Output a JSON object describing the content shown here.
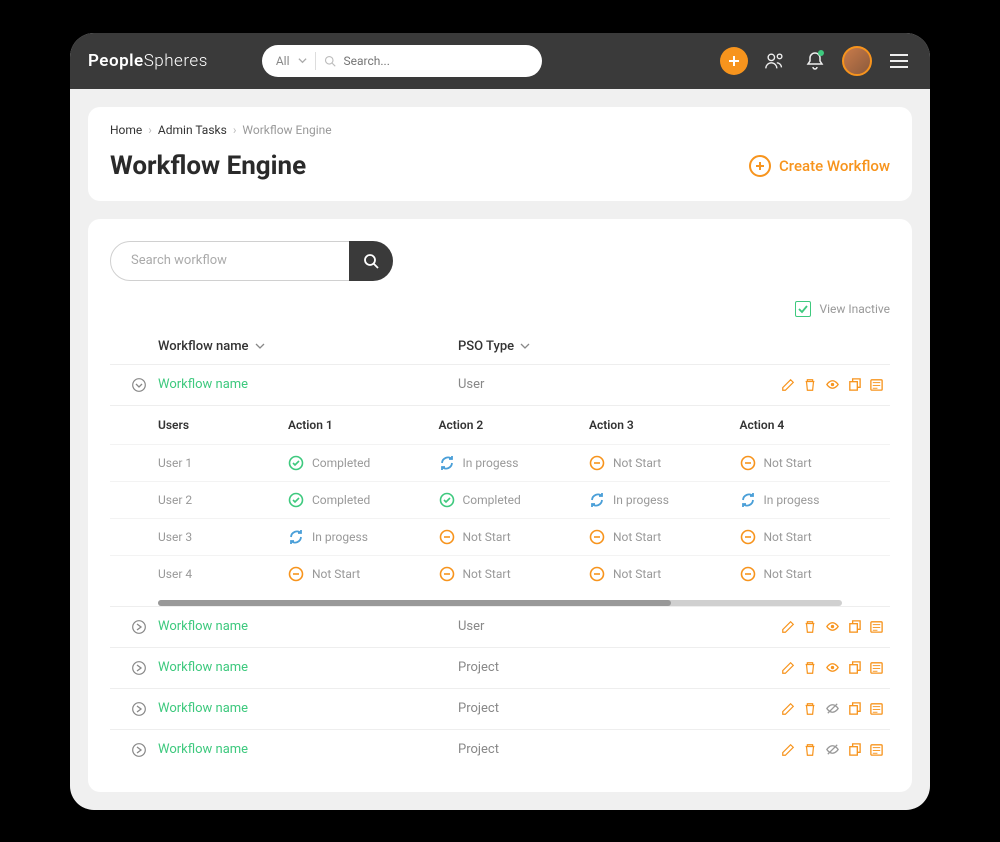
{
  "logo": {
    "p1": "People",
    "p2": "Spheres"
  },
  "topsearch": {
    "scope": "All",
    "placeholder": "Search..."
  },
  "breadcrumb": {
    "a": "Home",
    "b": "Admin Tasks",
    "c": "Workflow Engine"
  },
  "page_title": "Workflow Engine",
  "create_label": "Create Workflow",
  "search_placeholder": "Search workflow",
  "view_inactive": "View Inactive",
  "columns": {
    "name": "Workflow name",
    "type": "PSO Type"
  },
  "detail_cols": {
    "users": "Users",
    "a1": "Action 1",
    "a2": "Action 2",
    "a3": "Action 3",
    "a4": "Action 4"
  },
  "statuses": {
    "completed": "Completed",
    "inprogress": "In progess",
    "notstart": "Not Start"
  },
  "rows": [
    {
      "name": "Workflow name",
      "type": "User",
      "expanded": true,
      "hidden": false,
      "users": [
        {
          "name": "User 1",
          "a1": "completed",
          "a2": "inprogress",
          "a3": "notstart",
          "a4": "notstart"
        },
        {
          "name": "User 2",
          "a1": "completed",
          "a2": "completed",
          "a3": "inprogress",
          "a4": "inprogress"
        },
        {
          "name": "User 3",
          "a1": "inprogress",
          "a2": "notstart",
          "a3": "notstart",
          "a4": "notstart"
        },
        {
          "name": "User 4",
          "a1": "notstart",
          "a2": "notstart",
          "a3": "notstart",
          "a4": "notstart"
        }
      ]
    },
    {
      "name": "Workflow name",
      "type": "User",
      "expanded": false,
      "hidden": false
    },
    {
      "name": "Workflow name",
      "type": "Project",
      "expanded": false,
      "hidden": false
    },
    {
      "name": "Workflow name",
      "type": "Project",
      "expanded": false,
      "hidden": true
    },
    {
      "name": "Workflow name",
      "type": "Project",
      "expanded": false,
      "hidden": true
    }
  ],
  "colors": {
    "accent": "#f7941d",
    "green": "#3ec97e",
    "blue": "#4a9fd8"
  }
}
